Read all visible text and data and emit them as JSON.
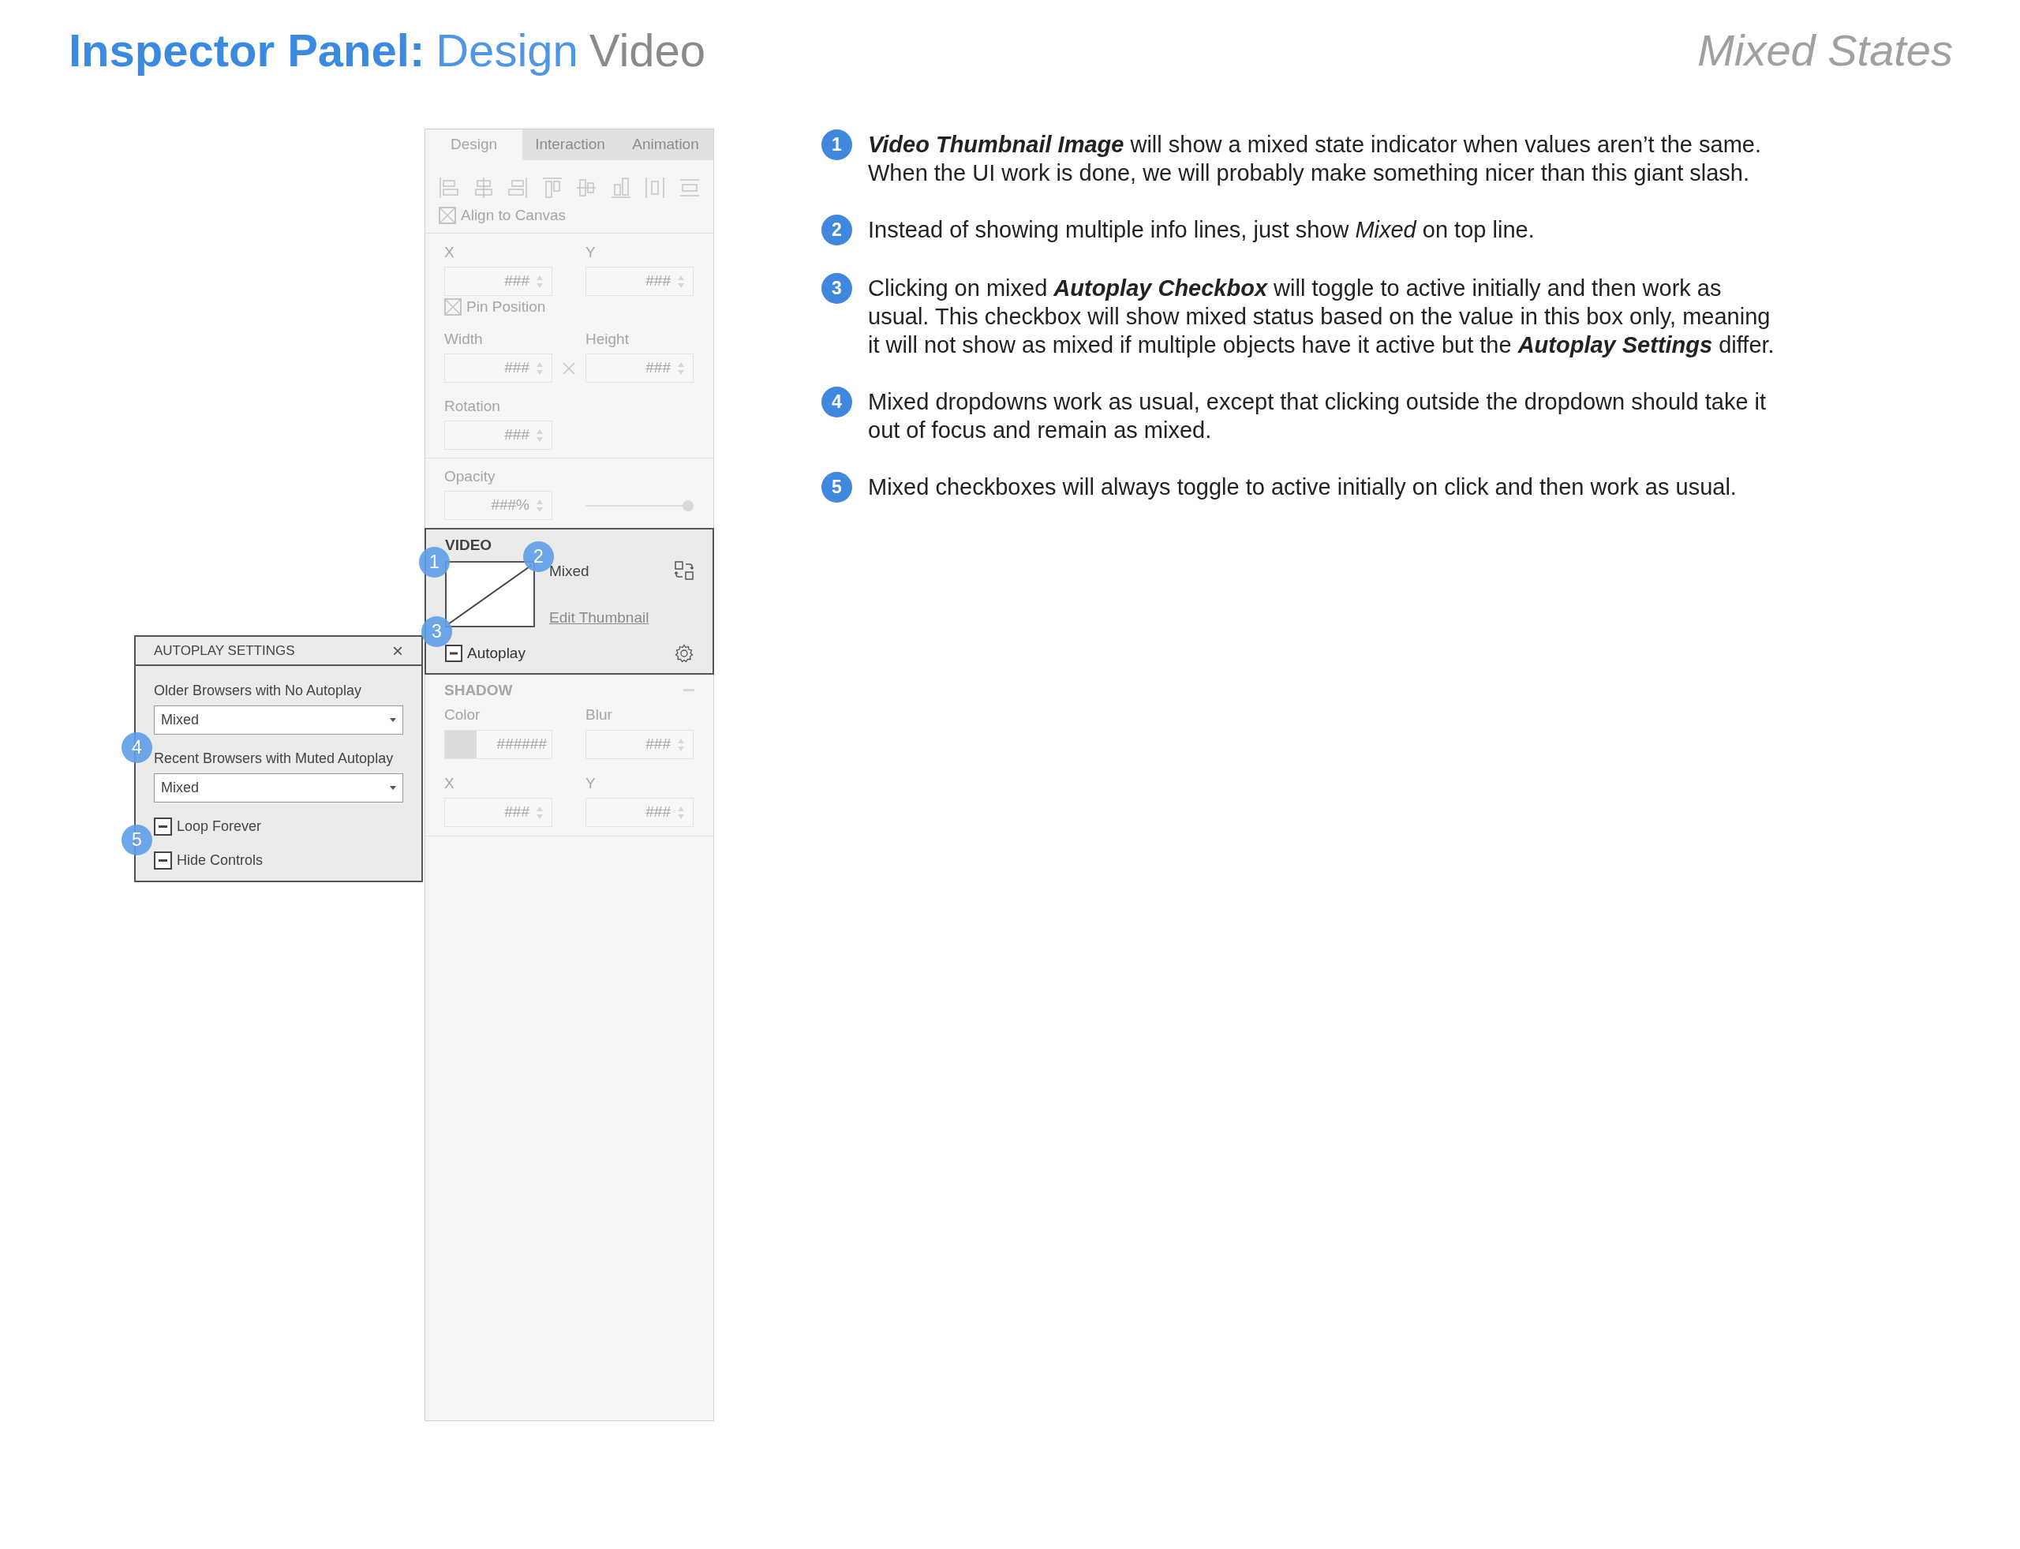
{
  "header": {
    "title_bold": "Inspector Panel:",
    "title_section": "Design",
    "title_item": "Video",
    "subtitle": "Mixed States"
  },
  "inspector": {
    "tabs": [
      {
        "label": "Design",
        "selected": true
      },
      {
        "label": "Interaction",
        "selected": false
      },
      {
        "label": "Animation",
        "selected": false
      }
    ],
    "transform": {
      "disabled": true,
      "align_to_canvas": {
        "label": "Align to Canvas",
        "crossed": true
      },
      "x": {
        "label": "X",
        "value": "###"
      },
      "y": {
        "label": "Y",
        "value": "###"
      },
      "pin_position": {
        "label": "Pin Position",
        "crossed": true
      },
      "width": {
        "label": "Width",
        "value": "###"
      },
      "height": {
        "label": "Height",
        "value": "###"
      },
      "rotation": {
        "label": "Rotation",
        "value": "###"
      }
    },
    "opacity": {
      "disabled": true,
      "label": "Opacity",
      "value": "###%",
      "level": 1
    },
    "video": {
      "disabled": false,
      "title": "VIDEO",
      "thumbnail_mixed": true,
      "info": "Mixed",
      "link": "Edit Thumbnail",
      "autoplay": {
        "label": "Autoplay",
        "mixed": true
      }
    },
    "shadow": {
      "disabled": true,
      "title": "SHADOW",
      "color": {
        "label": "Color",
        "value": "######"
      },
      "blur": {
        "label": "Blur",
        "value": "###"
      },
      "x": {
        "label": "X",
        "value": "###"
      },
      "y": {
        "label": "Y",
        "value": "###"
      }
    }
  },
  "autoplay_settings": {
    "title": "AUTOPLAY SETTINGS",
    "close": "×",
    "dropdowns": [
      {
        "label": "Older Browsers with No Autoplay",
        "value": "Mixed"
      },
      {
        "label": "Recent Browsers with Muted Autoplay",
        "value": "Mixed"
      }
    ],
    "checkboxes": [
      {
        "label": "Loop Forever",
        "mixed": true
      },
      {
        "label": "Hide Controls",
        "mixed": true
      }
    ]
  },
  "markers": [
    "1",
    "2",
    "3",
    "4",
    "5"
  ],
  "notes": [
    {
      "number": "1",
      "text": "**Video Thumbnail Image** will show a mixed state indicator when values aren’t the same. When the UI work is done, we will probably make something nicer than this giant slash."
    },
    {
      "number": "2",
      "text": "Instead of showing multiple info lines, just show *Mixed* on top line."
    },
    {
      "number": "3",
      "text": "Clicking on mixed **Autoplay Checkbox** will toggle to active initially and then work as usual. This checkbox will show mixed status based on the value in this box only, meaning it will not show as mixed if multiple objects have it active but the **Autoplay Settings** differ."
    },
    {
      "number": "4",
      "text": "Mixed dropdowns work as usual, except that clicking outside the dropdown should take it out of focus and remain as mixed."
    },
    {
      "number": "5",
      "text": "Mixed checkboxes will always toggle to active initially on click and then work as usual."
    }
  ]
}
